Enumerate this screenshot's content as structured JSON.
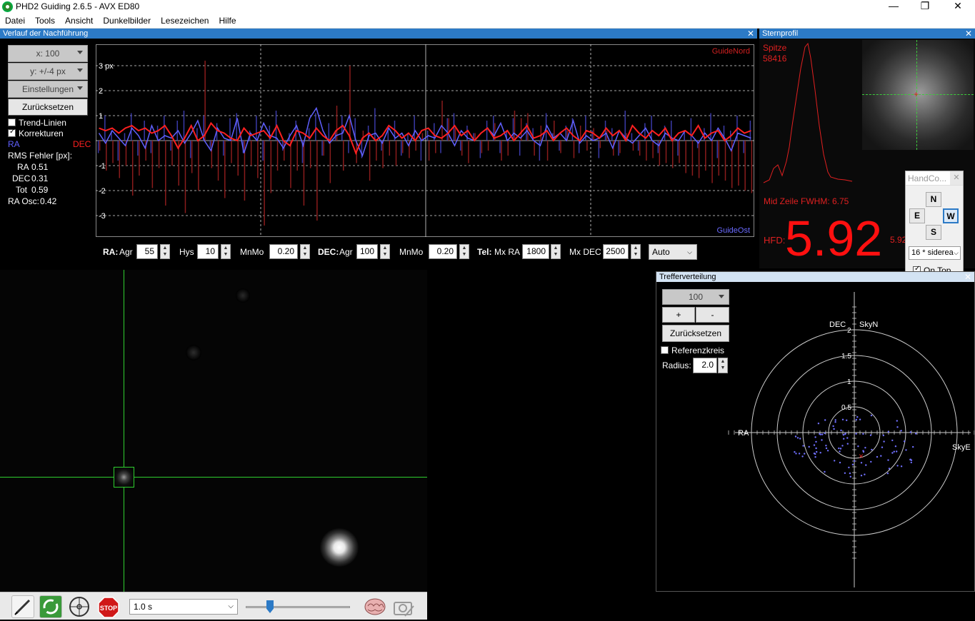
{
  "window": {
    "title": "PHD2 Guiding 2.6.5 - AVX ED80",
    "minimize": "—",
    "maximize": "❐",
    "close": "✕"
  },
  "menu": [
    "Datei",
    "Tools",
    "Ansicht",
    "Dunkelbilder",
    "Lesezeichen",
    "Hilfe"
  ],
  "graph_panel": {
    "title": "Verlauf der Nachführung",
    "x_select": "x: 100",
    "y_select": "y: +/-4 px",
    "settings_btn": "Einstellungen",
    "reset_btn": "Zurücksetzen",
    "trend_label": "Trend-Linien",
    "corrections_label": "Korrekturen",
    "ra_label": "RA",
    "dec_label": "DEC",
    "rms_title": "RMS Fehler [px]:",
    "rms_ra_label": "RA",
    "rms_ra": "0.51",
    "rms_dec_label": "DEC",
    "rms_dec": "0.31",
    "rms_tot_label": "Tot",
    "rms_tot": "0.59",
    "ra_osc_label": "RA Osc:",
    "ra_osc": "0.42",
    "guide_north": "GuideNord",
    "guide_east": "GuideOst",
    "y_ticks": [
      "3 px",
      "2",
      "1",
      "-1",
      "-2",
      "-3"
    ],
    "colors": {
      "ra": "#6060ff",
      "dec": "#ff2020"
    }
  },
  "chart_data": {
    "type": "line",
    "title": "",
    "xlabel": "",
    "ylabel": "px",
    "ylim": [
      -4,
      4
    ],
    "xlim": [
      0,
      100
    ],
    "grid": true,
    "y_tick_labels": [
      "3 px",
      "2",
      "1",
      "-1",
      "-2",
      "-3"
    ],
    "series": [
      {
        "name": "RA",
        "values": [
          0.3,
          -0.1,
          0.4,
          0.1,
          -0.2,
          0.5,
          0.2,
          -0.3,
          0.6,
          0.0,
          0.2,
          0.1,
          0.4,
          -0.1,
          0.3,
          0.8,
          0.0,
          -0.4,
          0.5,
          0.1,
          0.0,
          0.9,
          -0.5,
          0.3,
          0.0,
          0.7,
          0.2,
          0.1,
          -0.3,
          0.2,
          0.6,
          -0.2,
          0.9,
          1.3,
          0.4,
          -0.1,
          0.2,
          0.3,
          1.0,
          0.0,
          -0.6,
          0.2,
          0.3,
          -0.1,
          0.5,
          0.1,
          0.3,
          -0.2,
          0.4,
          0.0,
          0.2,
          0.1,
          0.6,
          0.3,
          -0.2,
          0.4,
          0.1,
          0.0,
          0.3,
          0.5,
          0.2,
          0.7,
          0.0,
          0.3,
          0.1,
          0.4,
          0.0,
          -0.2,
          0.6,
          0.1,
          0.3,
          0.0,
          0.8,
          -0.1,
          0.2,
          0.0,
          0.1,
          0.3,
          -0.3,
          0.4,
          0.1,
          -0.1,
          0.2,
          0.5,
          0.0,
          -0.2,
          0.3,
          0.1,
          0.0,
          0.4,
          0.2,
          -0.1,
          0.3,
          0.0,
          0.5,
          0.1,
          -0.4,
          0.3,
          0.2,
          0.1
        ]
      },
      {
        "name": "DEC",
        "values": [
          0.5,
          0.4,
          0.5,
          0.3,
          0.5,
          0.6,
          0.4,
          0.5,
          0.3,
          0.4,
          0.6,
          0.2,
          -0.3,
          0.1,
          0.6,
          0.0,
          0.2,
          0.7,
          0.4,
          0.3,
          0.1,
          0.0,
          0.5,
          0.2,
          0.3,
          0.4,
          0.1,
          0.6,
          0.0,
          -0.2,
          0.4,
          0.3,
          0.1,
          0.5,
          0.2,
          0.0,
          0.4,
          0.6,
          0.2,
          -0.5,
          0.1,
          0.3,
          0.0,
          0.2,
          0.6,
          0.4,
          0.1,
          0.3,
          0.0,
          0.4,
          0.5,
          0.2,
          0.1,
          0.3,
          0.6,
          0.2,
          0.4,
          0.0,
          0.3,
          0.5,
          0.1,
          0.2,
          0.4,
          0.0,
          0.3,
          0.6,
          0.1,
          0.2,
          0.4,
          0.0,
          0.3,
          0.5,
          0.2,
          0.0,
          0.4,
          0.3,
          0.1,
          0.5,
          0.2,
          0.4,
          0.0,
          0.6,
          0.3,
          0.1,
          0.4,
          0.2,
          0.5,
          0.0,
          0.3,
          0.4,
          0.2,
          0.6,
          0.1,
          0.3,
          0.4,
          0.0,
          0.2,
          0.5,
          0.3,
          0.4
        ]
      },
      {
        "name": "RA corrections",
        "values": [
          -0.5,
          1.0,
          0.4,
          -0.8,
          0.3,
          1.1,
          -0.6,
          0.8,
          -0.5,
          0.6,
          1.0,
          -0.4,
          0.8,
          1.2,
          -0.7,
          0.5,
          1.0,
          -0.3,
          0.7,
          -0.6,
          0.9,
          1.1,
          -0.5,
          0.4,
          1.0,
          -0.8,
          0.6,
          1.2,
          -0.4,
          0.3,
          0.8,
          -0.9,
          0.5,
          1.1,
          -0.6,
          0.7,
          0.4,
          1.0,
          -0.5,
          0.9,
          -0.7,
          0.6,
          1.3,
          -0.4,
          0.5,
          0.8,
          -0.6,
          0.3,
          1.0,
          -0.8,
          0.4,
          0.7,
          -0.5,
          0.9,
          1.1,
          -0.4,
          0.6,
          0.3,
          -0.7,
          0.8,
          1.0,
          -0.5,
          0.4,
          0.9,
          -0.6,
          0.7,
          0.5,
          -0.8,
          1.1,
          0.3,
          -0.4,
          0.6,
          0.9,
          -0.5,
          1.0,
          0.4,
          -0.7,
          0.8,
          0.5,
          -0.6,
          1.2,
          0.3,
          -0.4,
          0.7,
          1.0,
          -0.5,
          0.6,
          0.8,
          -0.6,
          0.4,
          0.9,
          -0.3,
          0.5,
          1.1,
          -0.7,
          0.6,
          0.4,
          1.0,
          -0.5,
          0.8
        ]
      },
      {
        "name": "DEC corrections",
        "values": [
          -0.4,
          -1.2,
          -0.9,
          -1.5,
          -1.0,
          -2.2,
          -1.4,
          -0.8,
          -1.9,
          -1.1,
          -2.6,
          -1.0,
          -1.8,
          -2.9,
          -1.3,
          -2.0,
          3.2,
          -1.1,
          -1.6,
          -2.3,
          -0.9,
          -1.4,
          -2.4,
          -1.0,
          -1.5,
          -3.4,
          -2.1,
          -1.2,
          -0.8,
          -1.9,
          -1.2,
          -2.6,
          -1.1,
          -3.2,
          -0.6,
          -1.7,
          1.4,
          -1.2,
          3.0,
          -0.9,
          0.4,
          -1.6,
          -0.8,
          -1.1,
          -0.6,
          -1.0,
          -0.5,
          -0.7,
          -0.4,
          0.3,
          -0.8,
          -0.5,
          1.6,
          0.9,
          0.5,
          -0.6,
          -0.9,
          0.3,
          -0.5,
          -0.4,
          0.7,
          -0.8,
          -0.6,
          1.2,
          0.9,
          1.1,
          -0.6,
          0.6,
          -0.8,
          0.8,
          -0.5,
          0.4,
          -0.7,
          0.6,
          -0.4,
          0.5,
          -0.3,
          0.4,
          -0.6,
          -0.5,
          0.3,
          -0.4,
          -0.6,
          -0.8,
          -0.7,
          -1.0,
          -0.9,
          -1.1,
          -0.9,
          -1.3,
          -1.4,
          -1.5,
          -1.2,
          -1.7,
          -1.4,
          -1.6,
          -1.9,
          -1.8,
          -2.0,
          -2.1
        ]
      }
    ]
  },
  "params": {
    "ra_label": "RA:",
    "agr_label": "Agr",
    "ra_agr": "55",
    "hys_label": "Hys",
    "ra_hys": "10",
    "mnmo_label": "MnMo",
    "ra_mnmo": "0.20",
    "dec_label": "DEC:",
    "dec_agr_label": "Agr",
    "dec_agr": "100",
    "dec_mnmo_label": "MnMo",
    "dec_mnmo": "0.20",
    "tel_label": "Tel:",
    "mxra_label": "Mx RA",
    "mx_ra": "1800",
    "mxdec_label": "Mx DEC",
    "mx_dec": "2500",
    "mode": "Auto"
  },
  "star_profile": {
    "title": "Sternprofil",
    "peak_label": "Spitze",
    "peak_value": "58416",
    "fwhm": "Mid Zeile FWHM: 6.75",
    "hfd_label": "HFD:",
    "hfd_value": "5.92",
    "hfd_small": "5.92"
  },
  "handcontrol": {
    "title": "HandCo...",
    "close": "✕",
    "north": "N",
    "east": "E",
    "west": "W",
    "south": "S",
    "rate": "16 * siderea",
    "ontop": "On Top"
  },
  "scatter_panel": {
    "title": "Trefferverteilung",
    "count_select": "100",
    "plus": "+",
    "minus": "-",
    "reset": "Zurücksetzen",
    "ref_circle": "Referenzkreis",
    "radius_label": "Radius:",
    "radius_value": "2.0",
    "axis_dec": "DEC",
    "axis_skyn": "SkyN",
    "axis_ra": "RA",
    "axis_skye": "SkyE",
    "ring_labels": [
      "2",
      "1.5",
      "1",
      "0.5"
    ]
  },
  "toolbar": {
    "exposure": "1.0 s"
  }
}
